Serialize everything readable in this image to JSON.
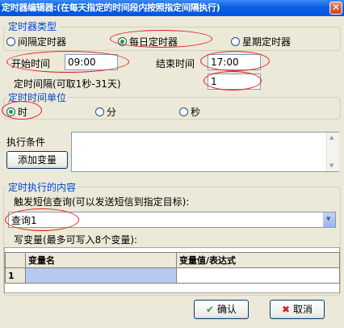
{
  "window": {
    "title": "定时器编辑器:(在每天指定的时间段内按照指定间隔执行)",
    "close_glyph": "✕"
  },
  "timer_type": {
    "legend": "定时器类型",
    "options": [
      {
        "label": "间隔定时器",
        "selected": false
      },
      {
        "label": "每日定时器",
        "selected": true
      },
      {
        "label": "星期定时器",
        "selected": false
      }
    ]
  },
  "schedule": {
    "start_label": "开始时间",
    "start_value": "09:00",
    "end_label": "结束时间",
    "end_value": "17:00",
    "interval_label": "定时间隔(可取1秒-31天)",
    "interval_value": "1"
  },
  "unit": {
    "legend": "定时时间单位",
    "options": [
      {
        "label": "时",
        "selected": true
      },
      {
        "label": "分",
        "selected": false
      },
      {
        "label": "秒",
        "selected": false
      }
    ]
  },
  "condition": {
    "label": "执行条件",
    "add_button": "添加变量",
    "text": ""
  },
  "content": {
    "legend": "定时执行的内容",
    "trigger_label": "触发短信查询(可以发送短信到指定目标):",
    "trigger_value": "查询1",
    "write_label": "写变量(最多可写入8个变量):",
    "columns": [
      "变量名",
      "变量值/表达式"
    ],
    "rows": [
      {
        "num": "1",
        "name": "",
        "value": ""
      }
    ]
  },
  "footer": {
    "ok_label": "确认",
    "cancel_label": "取消"
  },
  "colors": {
    "legend": "#0046D5",
    "annotation": "#E02020",
    "title_bar": "#0054E3"
  }
}
